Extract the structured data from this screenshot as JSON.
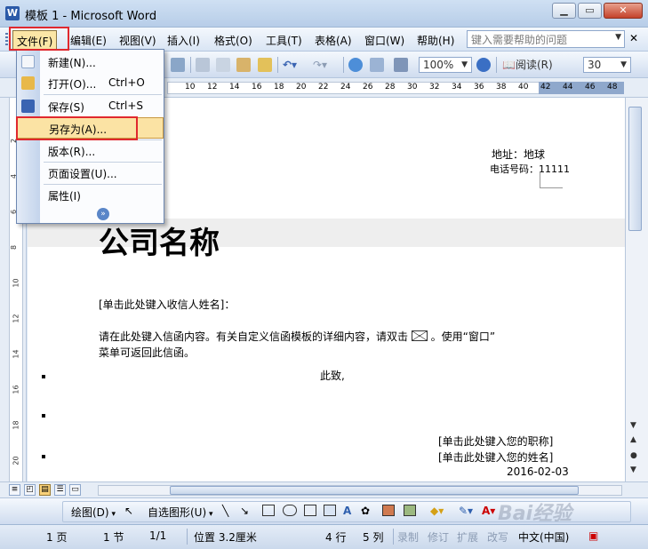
{
  "window": {
    "title": "模板 1 - Microsoft Word",
    "app_icon_letter": "W"
  },
  "menubar": {
    "items": [
      "文件(F)",
      "编辑(E)",
      "视图(V)",
      "插入(I)",
      "格式(O)",
      "工具(T)",
      "表格(A)",
      "窗口(W)",
      "帮助(H)"
    ],
    "help_placeholder": "键入需要帮助的问题"
  },
  "toolbar": {
    "zoom": "100%",
    "read_label": "阅读(R)",
    "font_size": "30"
  },
  "ruler": {
    "marks": [
      "10",
      "12",
      "14",
      "16",
      "18",
      "20",
      "22",
      "24",
      "26",
      "28",
      "30",
      "32",
      "34",
      "36",
      "38",
      "40",
      "42",
      "44",
      "46",
      "48"
    ]
  },
  "vruler": {
    "marks": [
      "2",
      "4",
      "6",
      "8",
      "10",
      "12",
      "14",
      "16",
      "18",
      "20"
    ]
  },
  "file_menu": {
    "items": [
      {
        "label": "新建(N)...",
        "shortcut": ""
      },
      {
        "label": "打开(O)...",
        "shortcut": "Ctrl+O"
      },
      {
        "label": "保存(S)",
        "shortcut": "Ctrl+S"
      },
      {
        "label": "另存为(A)...",
        "shortcut": ""
      },
      {
        "label": "版本(R)...",
        "shortcut": ""
      },
      {
        "label": "页面设置(U)...",
        "shortcut": ""
      },
      {
        "label": "属性(I)",
        "shortcut": ""
      }
    ],
    "highlighted": "另存为(A)..."
  },
  "document": {
    "address": "地址：地球",
    "phone": "电话号码：11111",
    "company": "公司名称",
    "recipient": "[单击此处键入收信人姓名]：",
    "body_line1": "请在此处键入信函内容。有关自定义信函模板的详细内容，请双击",
    "body_line1_end": "。使用“窗口”",
    "body_line2": "菜单可返回此信函。",
    "closing": "此致,",
    "title_placeholder": "[单击此处键入您的职称]",
    "name_placeholder": "[单击此处键入您的姓名]",
    "date": "2016-02-03"
  },
  "drawbar": {
    "draw_label": "绘图(D)",
    "autoshapes_label": "自选图形(U)",
    "watermark": "Bai经验"
  },
  "statusbar": {
    "page": "1 页",
    "section": "1 节",
    "page_of": "1/1",
    "position": "位置 3.2厘米",
    "line": "4 行",
    "column": "5 列",
    "rec": "录制",
    "trk": "修订",
    "ext": "扩展",
    "ovr": "改写",
    "language": "中文(中国)"
  },
  "colors": {
    "highlight": "#fbe3a4",
    "annotation": "#e0282e"
  }
}
